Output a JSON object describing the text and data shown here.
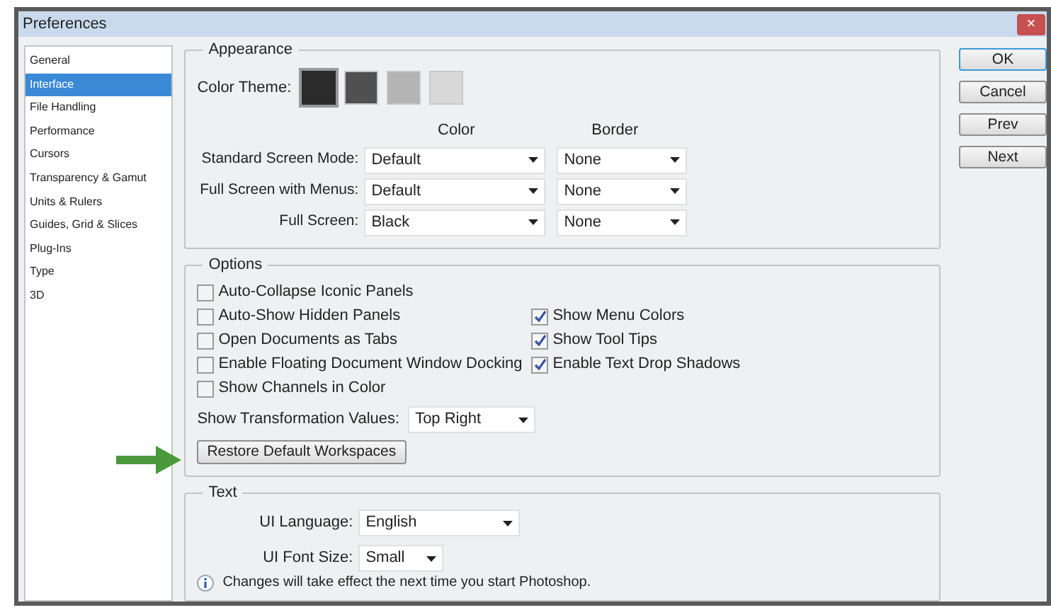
{
  "window": {
    "title": "Preferences",
    "close": "×"
  },
  "sidebar": {
    "items": [
      {
        "label": "General",
        "selected": false
      },
      {
        "label": "Interface",
        "selected": true
      },
      {
        "label": "File Handling",
        "selected": false
      },
      {
        "label": "Performance",
        "selected": false
      },
      {
        "label": "Cursors",
        "selected": false
      },
      {
        "label": "Transparency & Gamut",
        "selected": false
      },
      {
        "label": "Units & Rulers",
        "selected": false
      },
      {
        "label": "Guides, Grid & Slices",
        "selected": false
      },
      {
        "label": "Plug-Ins",
        "selected": false
      },
      {
        "label": "Type",
        "selected": false
      },
      {
        "label": "3D",
        "selected": false
      }
    ]
  },
  "appearance": {
    "title": "Appearance",
    "color_theme_label": "Color Theme:",
    "themes": [
      {
        "color": "#2b2b2b",
        "selected": true
      },
      {
        "color": "#505050",
        "selected": false
      },
      {
        "color": "#b4b4b4",
        "selected": false
      },
      {
        "color": "#d8d8d8",
        "selected": false
      }
    ],
    "column_headers": [
      "Color",
      "Border"
    ],
    "rows": [
      {
        "label": "Standard Screen Mode:",
        "color_mode": "Default",
        "border": "None"
      },
      {
        "label": "Full Screen with Menus:",
        "color_mode": "Default",
        "border": "None"
      },
      {
        "label": "Full Screen:",
        "color_mode": "Black",
        "border": "None"
      }
    ]
  },
  "options": {
    "title": "Options",
    "left": [
      {
        "label": "Auto-Collapse Iconic Panels",
        "checked": false
      },
      {
        "label": "Auto-Show Hidden Panels",
        "checked": false
      },
      {
        "label": "Open Documents as Tabs",
        "checked": false
      },
      {
        "label": "Enable Floating Document Window Docking",
        "checked": false
      },
      {
        "label": "Show Channels in Color",
        "checked": false
      }
    ],
    "right": [
      {
        "label": "Show Menu Colors",
        "checked": true
      },
      {
        "label": "Show Tool Tips",
        "checked": true
      },
      {
        "label": "Enable Text Drop Shadows",
        "checked": true
      }
    ],
    "transformation_label": "Show Transformation Values:",
    "transformation_value": "Top Right",
    "restore_button": "Restore Default Workspaces"
  },
  "text": {
    "title": "Text",
    "language_label": "UI Language:",
    "language_value": "English",
    "font_size_label": "UI Font Size:",
    "font_size_value": "Small",
    "note": "Changes will take effect the next time you start Photoshop."
  },
  "buttons": [
    "OK",
    "Cancel",
    "Prev",
    "Next"
  ]
}
